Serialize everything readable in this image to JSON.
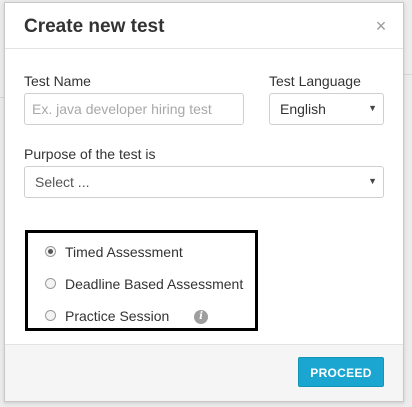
{
  "dialog": {
    "title": "Create new test",
    "close_label": "×"
  },
  "form": {
    "test_name": {
      "label": "Test Name",
      "value": "",
      "placeholder": "Ex. java developer hiring test"
    },
    "test_language": {
      "label": "Test Language",
      "selected": "English"
    },
    "purpose": {
      "label": "Purpose of the test is",
      "selected": "Select ..."
    },
    "test_type": {
      "options": [
        {
          "label": "Timed Assessment",
          "checked": true
        },
        {
          "label": "Deadline Based Assessment",
          "checked": false
        },
        {
          "label": "Practice Session",
          "checked": false,
          "info_icon": "info-icon"
        }
      ]
    }
  },
  "footer": {
    "proceed_label": "PROCEED"
  },
  "colors": {
    "primary_button": "#1ba6d1",
    "highlight_border": "#000000"
  }
}
